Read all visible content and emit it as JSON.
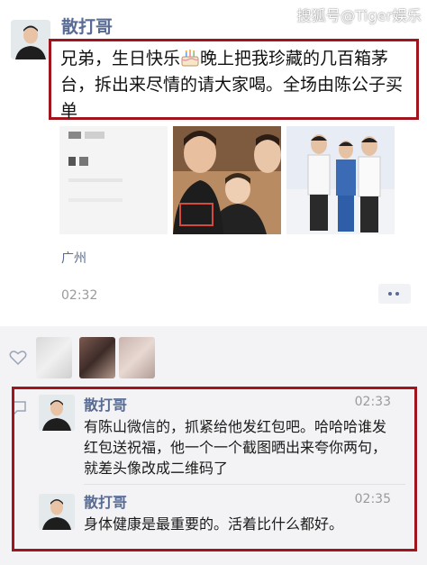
{
  "watermark": "搜狐号@Tiger娱乐",
  "post": {
    "author": "散打哥",
    "text_before_emoji": "兄弟，生日快乐",
    "text_after_emoji": "晚上把我珍藏的几百箱茅台，拆出来尽情的请大家喝。全场由陈公子买单",
    "emoji_icon": "birthday-cake-icon",
    "location": "广州",
    "time": "02:32",
    "photo_count": 3
  },
  "interactions": {
    "like_icon": "heart-icon",
    "comment_icon": "comment-icon",
    "comments": [
      {
        "author": "散打哥",
        "time": "02:33",
        "text": "有陈山微信的，抓紧给他发红包吧。哈哈哈谁发红包送祝福，他一个一个截图晒出来夸你两句，就差头像改成二维码了"
      },
      {
        "author": "散打哥",
        "time": "02:35",
        "text": "身体健康是最重要的。活着比什么都好。"
      }
    ]
  },
  "colors": {
    "link_blue": "#576b95",
    "highlight_red": "#a0141e",
    "comment_bg": "#f3f3f5"
  }
}
